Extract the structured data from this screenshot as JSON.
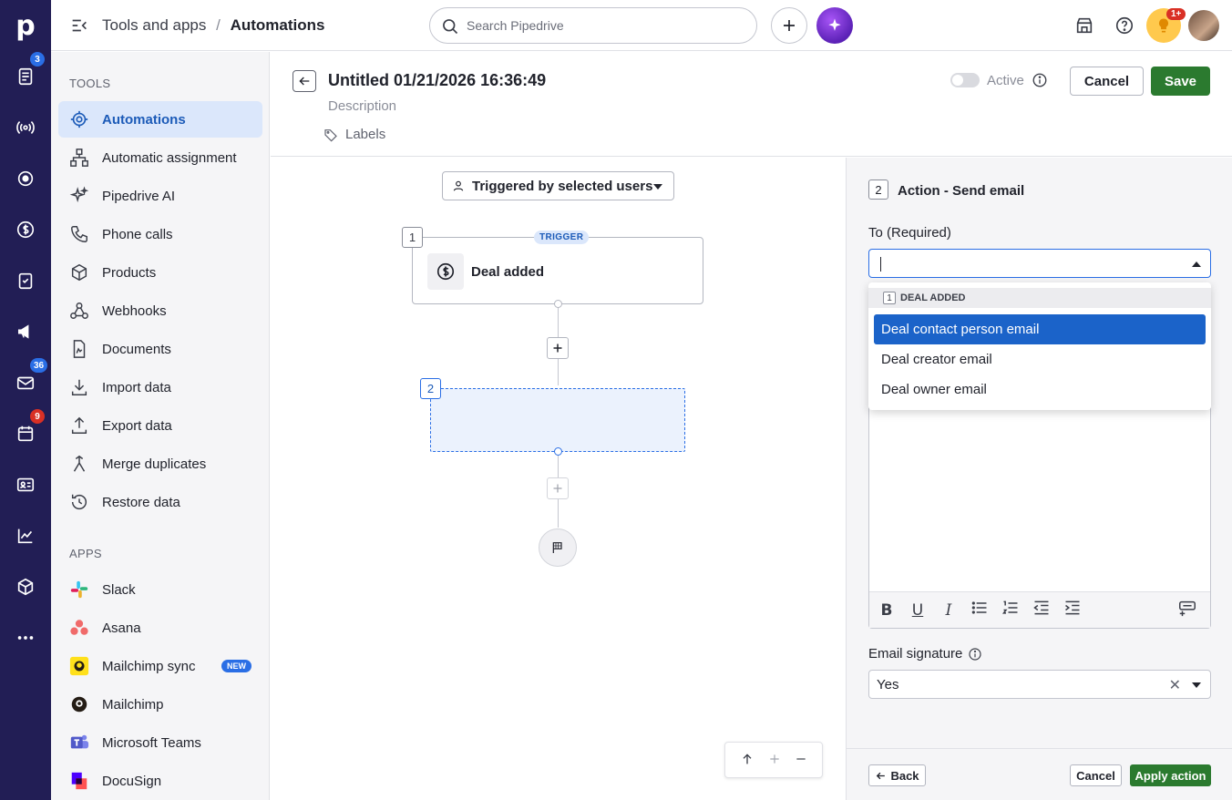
{
  "rail": {
    "logo": "p",
    "badges": {
      "activities": "3",
      "mail": "36",
      "calendar": "9"
    },
    "colors": {
      "bg": "#221e55",
      "badge_blue": "#2a6ee5",
      "badge_red": "#d93025"
    }
  },
  "topbar": {
    "breadcrumb_parent": "Tools and apps",
    "breadcrumb_sep": "/",
    "breadcrumb_current": "Automations",
    "search_placeholder": "Search Pipedrive",
    "notif_badge": "1+"
  },
  "sidebar": {
    "tools_heading": "TOOLS",
    "tools": [
      {
        "label": "Automations",
        "icon": "automation-icon",
        "active": true
      },
      {
        "label": "Automatic assignment",
        "icon": "assignment-icon"
      },
      {
        "label": "Pipedrive AI",
        "icon": "sparkle-icon"
      },
      {
        "label": "Phone calls",
        "icon": "phone-icon"
      },
      {
        "label": "Products",
        "icon": "box-icon"
      },
      {
        "label": "Webhooks",
        "icon": "webhook-icon"
      },
      {
        "label": "Documents",
        "icon": "document-icon"
      },
      {
        "label": "Import data",
        "icon": "import-icon"
      },
      {
        "label": "Export data",
        "icon": "export-icon"
      },
      {
        "label": "Merge duplicates",
        "icon": "merge-icon"
      },
      {
        "label": "Restore data",
        "icon": "restore-icon"
      }
    ],
    "apps_heading": "APPS",
    "apps": [
      {
        "label": "Slack",
        "icon": "slack-icon"
      },
      {
        "label": "Asana",
        "icon": "asana-icon"
      },
      {
        "label": "Mailchimp sync",
        "icon": "mailchimp-icon",
        "badge": "NEW"
      },
      {
        "label": "Mailchimp",
        "icon": "mailchimp-icon"
      },
      {
        "label": "Microsoft Teams",
        "icon": "teams-icon"
      },
      {
        "label": "DocuSign",
        "icon": "docusign-icon"
      }
    ]
  },
  "header": {
    "title": "Untitled 01/21/2026 16:36:49",
    "description": "Description",
    "labels": "Labels",
    "active_label": "Active",
    "active_on": false,
    "cancel": "Cancel",
    "save": "Save"
  },
  "canvas": {
    "trigger_select": "Triggered by selected users",
    "node1_number": "1",
    "node1_badge": "TRIGGER",
    "node1_label": "Deal added",
    "node2_number": "2"
  },
  "panel": {
    "step_number": "2",
    "title": "Action - Send email",
    "to_label": "To (Required)",
    "to_value": "",
    "dropdown": {
      "group_number": "1",
      "group_label": "DEAL ADDED",
      "options": [
        {
          "label": "Deal contact person email",
          "selected": true
        },
        {
          "label": "Deal creator email",
          "selected": false
        },
        {
          "label": "Deal owner email",
          "selected": false
        }
      ]
    },
    "editor_toolbar": [
      "B",
      "U",
      "I",
      "bullet-list",
      "numbered-list",
      "outdent",
      "indent",
      "insert-field"
    ],
    "signature_label": "Email signature",
    "signature_value": "Yes",
    "back": "Back",
    "cancel": "Cancel",
    "apply": "Apply action"
  }
}
